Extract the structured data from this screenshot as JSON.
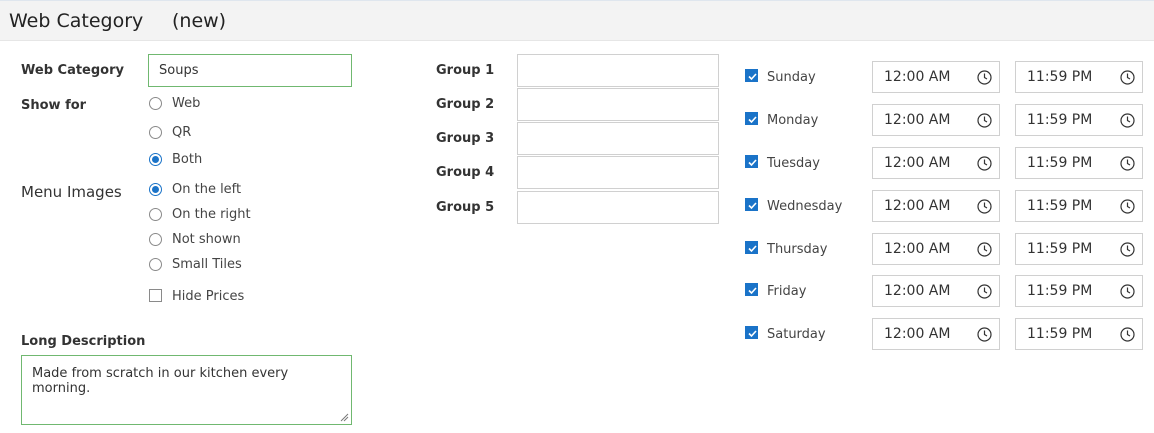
{
  "header": {
    "title": "Web Category",
    "status": "(new)"
  },
  "form": {
    "web_category_label": "Web Category",
    "web_category_value": "Soups",
    "show_for_label": "Show for",
    "show_for_options": [
      "Web",
      "QR",
      "Both"
    ],
    "show_for_selected": "Both",
    "menu_images_label": "Menu Images",
    "menu_images_options": [
      "On the left",
      "On the right",
      "Not shown",
      "Small Tiles"
    ],
    "menu_images_selected": "On the left",
    "hide_prices_label": "Hide Prices",
    "hide_prices_checked": false,
    "long_description_label": "Long Description",
    "long_description_value": "Made from scratch in our kitchen every morning."
  },
  "groups": [
    {
      "label": "Group 1",
      "value": ""
    },
    {
      "label": "Group 2",
      "value": ""
    },
    {
      "label": "Group 3",
      "value": ""
    },
    {
      "label": "Group 4",
      "value": ""
    },
    {
      "label": "Group 5",
      "value": ""
    }
  ],
  "schedule": [
    {
      "day": "Sunday",
      "checked": true,
      "start": "12:00 AM",
      "end": "11:59 PM"
    },
    {
      "day": "Monday",
      "checked": true,
      "start": "12:00 AM",
      "end": "11:59 PM"
    },
    {
      "day": "Tuesday",
      "checked": true,
      "start": "12:00 AM",
      "end": "11:59 PM"
    },
    {
      "day": "Wednesday",
      "checked": true,
      "start": "12:00 AM",
      "end": "11:59 PM"
    },
    {
      "day": "Thursday",
      "checked": true,
      "start": "12:00 AM",
      "end": "11:59 PM"
    },
    {
      "day": "Friday",
      "checked": true,
      "start": "12:00 AM",
      "end": "11:59 PM"
    },
    {
      "day": "Saturday",
      "checked": true,
      "start": "12:00 AM",
      "end": "11:59 PM"
    }
  ],
  "colors": {
    "accent": "#1a73c8",
    "valid_border": "#70b870",
    "header_bg": "#f3f3f3"
  },
  "icons": {
    "time": "clock-icon",
    "resize": "resize-grip-icon"
  }
}
